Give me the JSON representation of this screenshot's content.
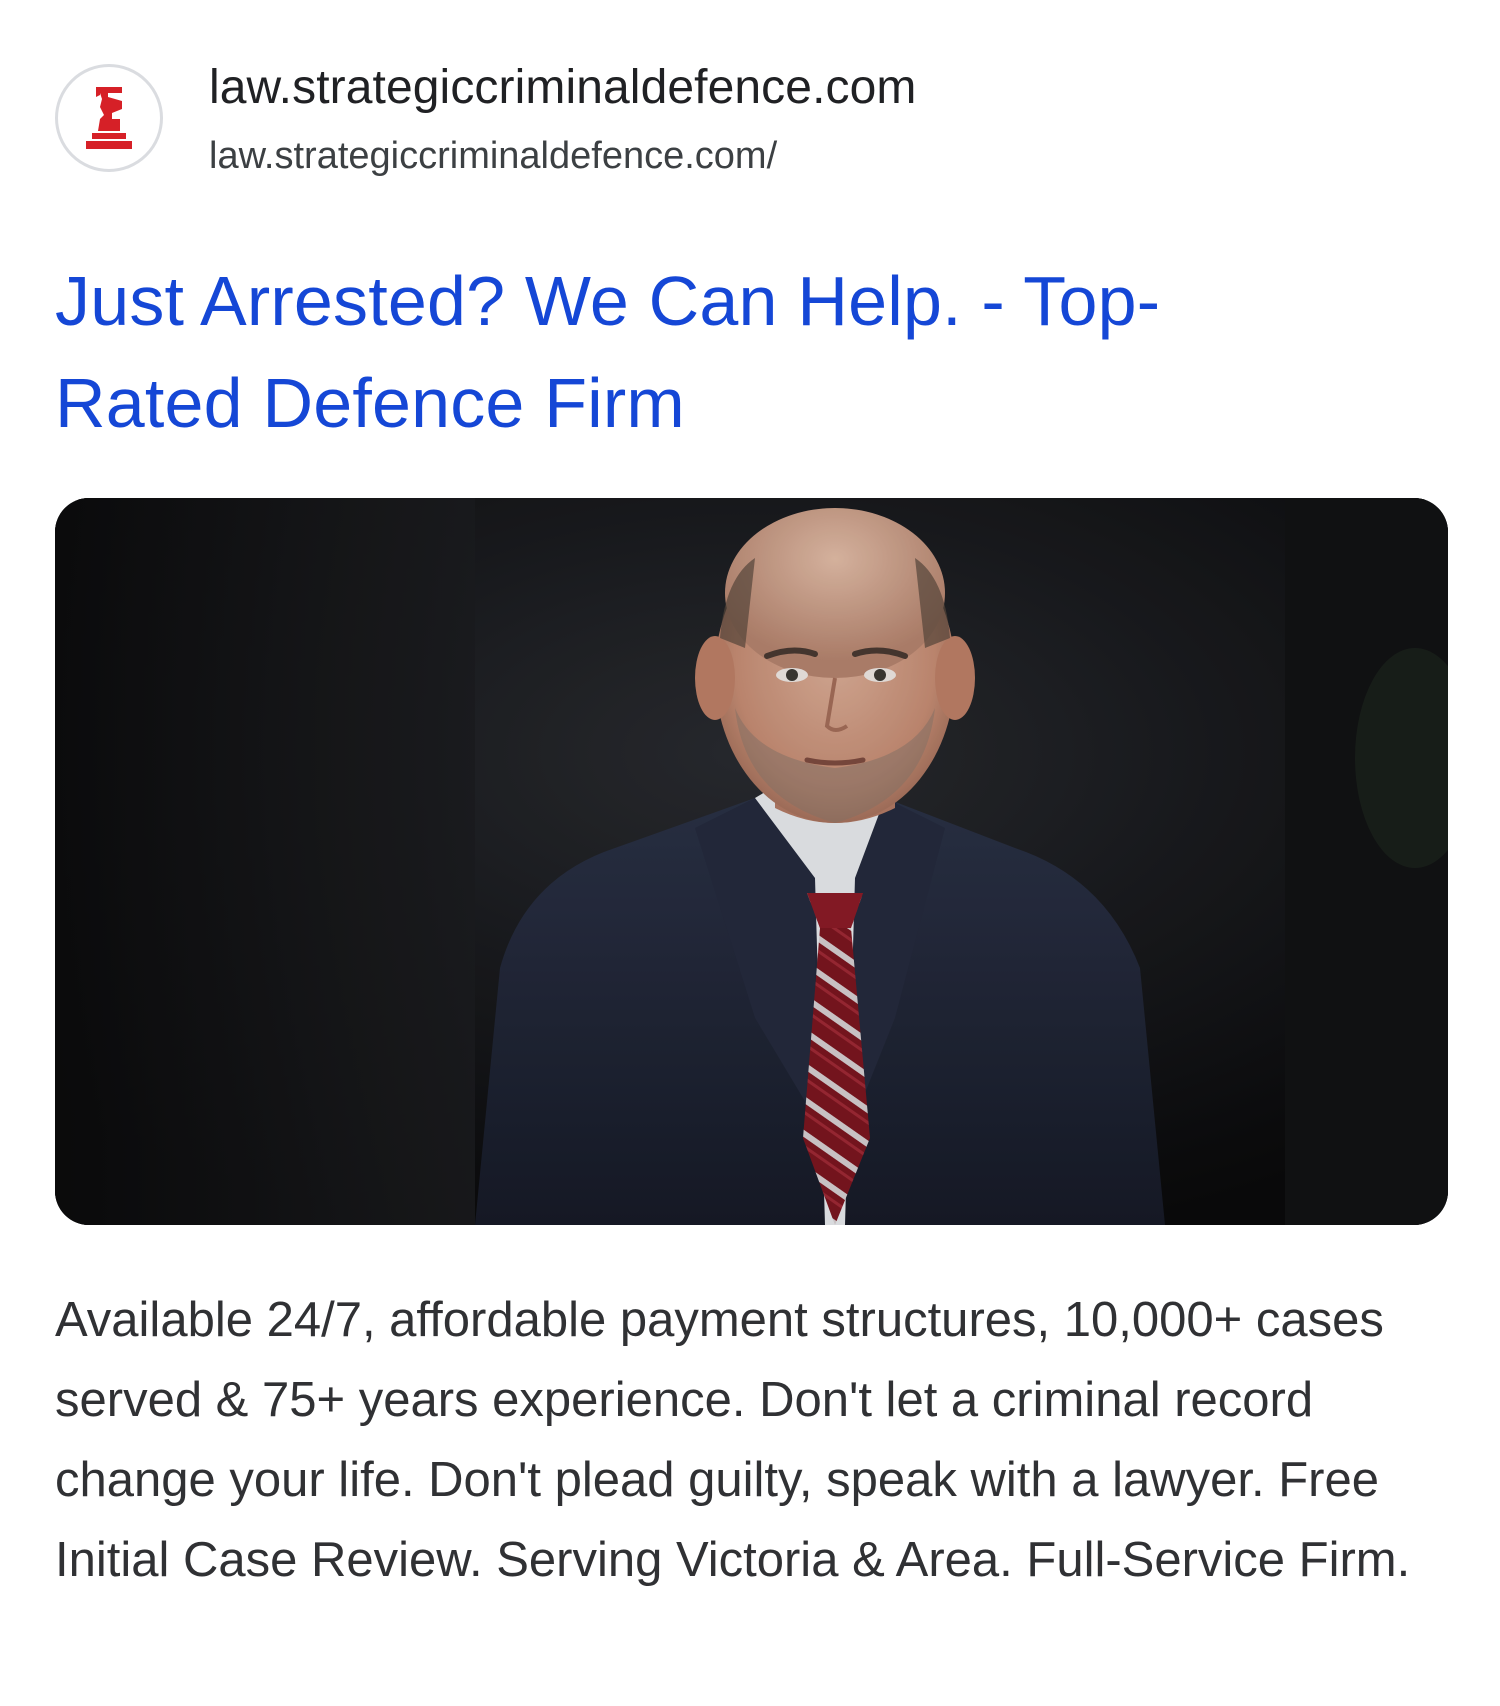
{
  "ad": {
    "site_name": "law.strategiccriminaldefence.com",
    "display_url": "law.strategiccriminaldefence.com/",
    "favicon_icon": "red-chess-knight-icon",
    "title_line1": "Just Arrested? We Can Help. - Top-",
    "title_line2": "Rated Defence Firm",
    "image_description": "lawyer-portrait-photo",
    "description": "Available 24/7, affordable payment structures, 10,000+ cases served & 75+ years experience. Don't let a criminal record change your life. Don't plead guilty, speak with a lawyer. Free Initial Case Review. Serving Victoria & Area. Full-Service Firm."
  },
  "colors": {
    "title_link": "#1547d6",
    "favicon_red": "#d62027",
    "text": "#202124"
  }
}
